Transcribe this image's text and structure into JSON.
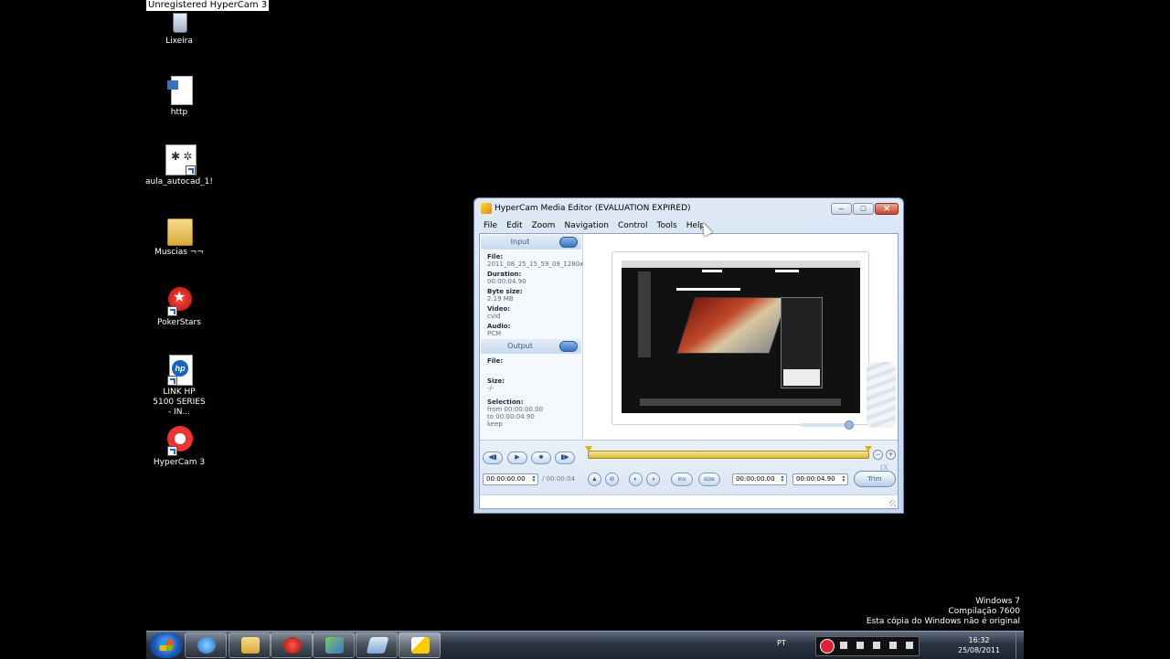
{
  "watermark": "Unregistered HyperCam 3",
  "desktop": {
    "icons": [
      {
        "label": "Lixeira"
      },
      {
        "label": "http"
      },
      {
        "label": "aula_autocad_1!"
      },
      {
        "label": "Muscias ¬¬"
      },
      {
        "label": "PokerStars"
      },
      {
        "label": "LINK HP 5100 SERIES - IN..."
      },
      {
        "label": "HyperCam 3"
      }
    ]
  },
  "window": {
    "title": "HyperCam Media Editor  (EVALUATION EXPIRED)",
    "menu": [
      "File",
      "Edit",
      "Zoom",
      "Navigation",
      "Control",
      "Tools",
      "Help"
    ],
    "input": {
      "header": "Input",
      "file_label": "File:",
      "file_value": "2011_08_25_15_59_09_1280x9",
      "duration_label": "Duration:",
      "duration_value": "00:00:04.90",
      "bytesize_label": "Byte size:",
      "bytesize_value": "2.19 MB",
      "video_label": "Video:",
      "video_value": "cvid",
      "audio_label": "Audio:",
      "audio_value": "PCM"
    },
    "output": {
      "header": "Output",
      "file_label": "File:",
      "size_label": "Size:",
      "size_value": "-/-",
      "selection_label": "Selection:",
      "from_line": "from 00:00:00.00",
      "to_line": "to      00:00:04.90",
      "keep_line": "keep"
    },
    "controls": {
      "zoom_level": "1X",
      "position_time": "00:00:00.00",
      "total_time": "/ 00:00:04",
      "inv_label": "inv",
      "size_label": "size",
      "sel_start": "00:00:00.00",
      "sel_end": "00:00:04.90",
      "trim_label": "Trim"
    }
  },
  "watermark_os": {
    "line1": "Windows 7",
    "line2": "Compilação 7600",
    "line3": "Esta cópia do Windows não é original"
  },
  "taskbar": {
    "lang": "PT",
    "time": "16:32",
    "date": "25/08/2011"
  }
}
